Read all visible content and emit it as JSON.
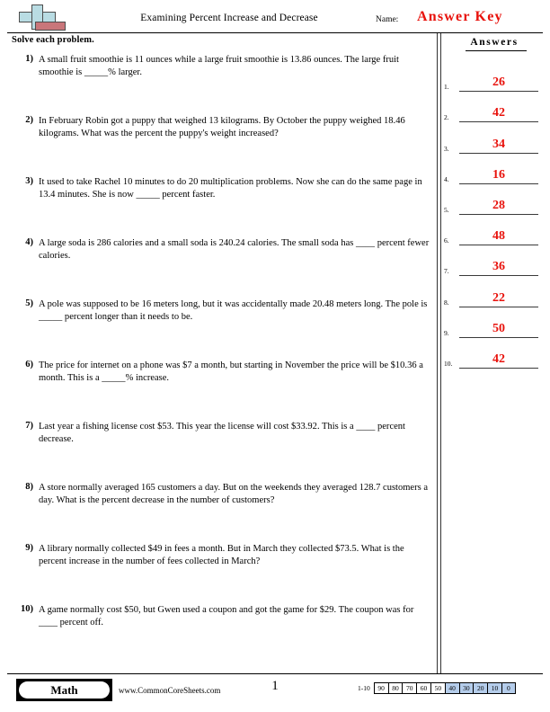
{
  "header": {
    "title": "Examining Percent Increase and Decrease",
    "name_label": "Name:",
    "answer_key": "Answer Key",
    "logo_icon": "plus-sign-logo",
    "logo_colors": {
      "plus": "#b9dce3",
      "bar": "#c9767a",
      "outline": "#4d4d4d"
    }
  },
  "instructions": "Solve each problem.",
  "answers_column": {
    "heading": "Answers",
    "answer_color": "#e8120c",
    "rows": [
      {
        "index": "1.",
        "value": "26"
      },
      {
        "index": "2.",
        "value": "42"
      },
      {
        "index": "3.",
        "value": "34"
      },
      {
        "index": "4.",
        "value": "16"
      },
      {
        "index": "5.",
        "value": "28"
      },
      {
        "index": "6.",
        "value": "48"
      },
      {
        "index": "7.",
        "value": "36"
      },
      {
        "index": "8.",
        "value": "22"
      },
      {
        "index": "9.",
        "value": "50"
      },
      {
        "index": "10.",
        "value": "42"
      }
    ]
  },
  "problems": [
    {
      "number": "1)",
      "text": "A small fruit smoothie is 11 ounces while a large fruit smoothie is 13.86 ounces. The large fruit smoothie is _____% larger."
    },
    {
      "number": "2)",
      "text": "In February Robin got a puppy that weighed 13 kilograms. By October the puppy weighed 18.46 kilograms. What was the percent the puppy's weight increased?"
    },
    {
      "number": "3)",
      "text": "It used to take Rachel 10 minutes to do 20 multiplication problems. Now she can do the same page in 13.4 minutes. She is now _____ percent faster."
    },
    {
      "number": "4)",
      "text": "A large soda is 286 calories and a small soda is 240.24 calories. The small soda has ____ percent fewer calories."
    },
    {
      "number": "5)",
      "text": "A pole was supposed to be 16 meters long, but it was accidentally made 20.48 meters long. The pole is _____ percent longer than it needs to be."
    },
    {
      "number": "6)",
      "text": "The price for internet on a phone was $7 a month, but starting in November the price will be $10.36 a month. This is a _____% increase."
    },
    {
      "number": "7)",
      "text": "Last year a fishing license cost $53. This year the license will cost $33.92. This is a ____ percent decrease."
    },
    {
      "number": "8)",
      "text": "A store normally averaged 165 customers a day. But on the weekends they averaged 128.7 customers a day. What is the percent decrease in the number of customers?"
    },
    {
      "number": "9)",
      "text": "A library normally collected $49 in fees a month. But in March they collected $73.5. What is the percent increase in the number of fees collected in March?"
    },
    {
      "number": "10)",
      "text": "A game normally cost $50, but Gwen used a coupon and got the game for $29. The coupon was for ____ percent off."
    }
  ],
  "footer": {
    "subject_badge": "Math",
    "site_url": "www.CommonCoreSheets.com",
    "page_number": "1",
    "score_range_label": "1-10",
    "highlight_color": "#b5cdeb",
    "score_boxes": [
      {
        "label": "90",
        "highlighted": false
      },
      {
        "label": "80",
        "highlighted": false
      },
      {
        "label": "70",
        "highlighted": false
      },
      {
        "label": "60",
        "highlighted": false
      },
      {
        "label": "50",
        "highlighted": false
      },
      {
        "label": "40",
        "highlighted": true
      },
      {
        "label": "30",
        "highlighted": true
      },
      {
        "label": "20",
        "highlighted": true
      },
      {
        "label": "10",
        "highlighted": true
      },
      {
        "label": "0",
        "highlighted": true
      }
    ]
  }
}
